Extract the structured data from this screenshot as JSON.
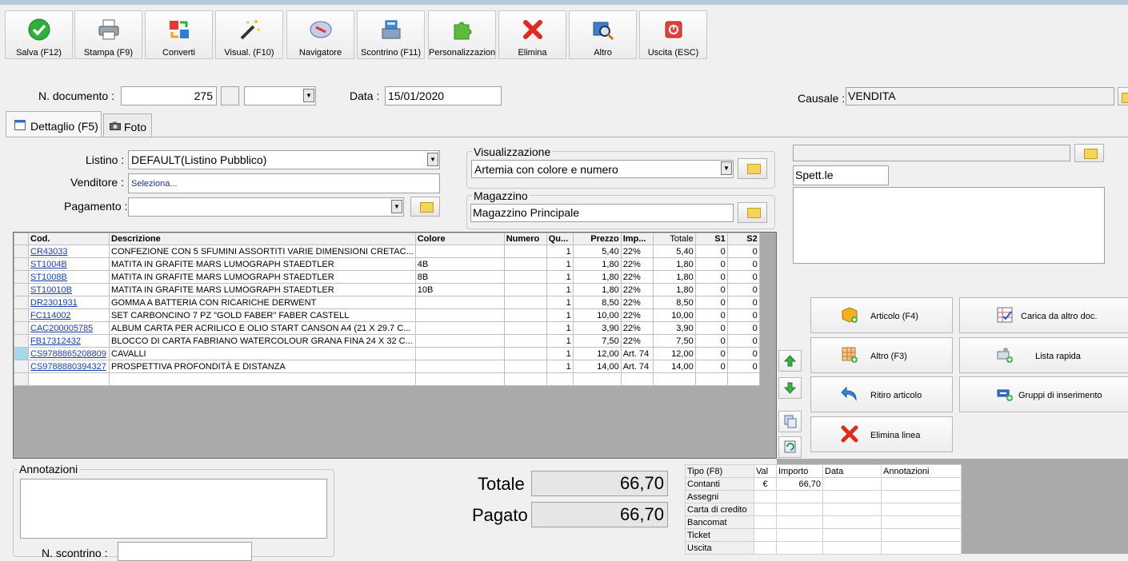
{
  "toolbar": {
    "items": [
      {
        "label": "Salva (F12)"
      },
      {
        "label": "Stampa (F9)"
      },
      {
        "label": "Converti"
      },
      {
        "label": "Visual. (F10)"
      },
      {
        "label": "Navigatore"
      },
      {
        "label": "Scontrino (F11)"
      },
      {
        "label": "Personalizzazioni"
      },
      {
        "label": "Elimina"
      },
      {
        "label": "Altro"
      },
      {
        "label": "Uscita (ESC)"
      }
    ]
  },
  "header": {
    "doc_label": "N. documento :",
    "doc_value": "275",
    "date_label": "Data :",
    "date_value": "15/01/2020",
    "causale_label": "Causale :",
    "causale_value": "VENDITA"
  },
  "tabs": [
    {
      "label": "Dettaglio (F5)"
    },
    {
      "label": "Foto"
    }
  ],
  "form": {
    "listino_label": "Listino :",
    "listino_value": "DEFAULT(Listino Pubblico)",
    "venditore_label": "Venditore :",
    "venditore_value": "Seleziona...",
    "pagamento_label": "Pagamento :",
    "pagamento_value": ""
  },
  "visualizzazione": {
    "label": "Visualizzazione",
    "value": "Artemia con colore e numero"
  },
  "magazzino": {
    "label": "Magazzino",
    "value": "Magazzino Principale"
  },
  "customer": {
    "name_value": "",
    "salutation": "Spett.le",
    "address": ""
  },
  "grid": {
    "columns": [
      "Cod.",
      "Descrizione",
      "Colore",
      "Numero",
      "Qu...",
      "Prezzo",
      "Imp...",
      "Totale",
      "S1",
      "S2"
    ],
    "rows": [
      {
        "cod": "CR43033",
        "desc": "CONFEZIONE CON 5 SFUMINI ASSORTITI VARIE DIMENSIONI CRETAC...",
        "colore": "",
        "numero": "",
        "qta": "1",
        "prezzo": "5,40",
        "imp": "22%",
        "totale": "5,40",
        "s1": "0",
        "s2": "0"
      },
      {
        "cod": "ST1004B",
        "desc": "MATITA IN GRAFITE MARS LUMOGRAPH STAEDTLER",
        "colore": "4B",
        "numero": "",
        "qta": "1",
        "prezzo": "1,80",
        "imp": "22%",
        "totale": "1,80",
        "s1": "0",
        "s2": "0"
      },
      {
        "cod": "ST1008B",
        "desc": "MATITA IN GRAFITE MARS LUMOGRAPH STAEDTLER",
        "colore": "8B",
        "numero": "",
        "qta": "1",
        "prezzo": "1,80",
        "imp": "22%",
        "totale": "1,80",
        "s1": "0",
        "s2": "0"
      },
      {
        "cod": "ST10010B",
        "desc": "MATITA IN GRAFITE MARS LUMOGRAPH STAEDTLER",
        "colore": "10B",
        "numero": "",
        "qta": "1",
        "prezzo": "1,80",
        "imp": "22%",
        "totale": "1,80",
        "s1": "0",
        "s2": "0"
      },
      {
        "cod": "DR2301931",
        "desc": "GOMMA A BATTERIA CON RICARICHE DERWENT",
        "colore": "",
        "numero": "",
        "qta": "1",
        "prezzo": "8,50",
        "imp": "22%",
        "totale": "8,50",
        "s1": "0",
        "s2": "0"
      },
      {
        "cod": "FC114002",
        "desc": "SET CARBONCINO 7 PZ \"GOLD FABER\" FABER CASTELL",
        "colore": "",
        "numero": "",
        "qta": "1",
        "prezzo": "10,00",
        "imp": "22%",
        "totale": "10,00",
        "s1": "0",
        "s2": "0"
      },
      {
        "cod": "CAC200005785",
        "desc": "ALBUM CARTA PER ACRILICO E OLIO START CANSON A4 (21 X 29.7 C...",
        "colore": "",
        "numero": "",
        "qta": "1",
        "prezzo": "3,90",
        "imp": "22%",
        "totale": "3,90",
        "s1": "0",
        "s2": "0"
      },
      {
        "cod": "FB17312432",
        "desc": "BLOCCO DI CARTA FABRIANO WATERCOLOUR GRANA FINA 24 X 32 C...",
        "colore": "",
        "numero": "",
        "qta": "1",
        "prezzo": "7,50",
        "imp": "22%",
        "totale": "7,50",
        "s1": "0",
        "s2": "0"
      },
      {
        "cod": "CS9788865208809",
        "desc": "CAVALLI",
        "colore": "",
        "numero": "",
        "qta": "1",
        "prezzo": "12,00",
        "imp": "Art. 74",
        "totale": "12,00",
        "s1": "0",
        "s2": "0"
      },
      {
        "cod": "CS9788880394327",
        "desc": "PROSPETTIVA PROFONDITÀ E DISTANZA",
        "colore": "",
        "numero": "",
        "qta": "1",
        "prezzo": "14,00",
        "imp": "Art. 74",
        "totale": "14,00",
        "s1": "0",
        "s2": "0"
      }
    ]
  },
  "actions": {
    "articolo": "Articolo (F4)",
    "carica": "Carica da altro doc.",
    "altro": "Altro (F3)",
    "lista": "Lista rapida",
    "ritiro": "Ritiro articolo",
    "gruppi": "Gruppi di inserimento",
    "elimina_linea": "Elimina linea"
  },
  "annotazioni": {
    "label": "Annotazioni",
    "value": ""
  },
  "scontrino": {
    "label": "N. scontrino :",
    "value": ""
  },
  "totals": {
    "totale_label": "Totale",
    "totale_value": "66,70",
    "pagato_label": "Pagato",
    "pagato_value": "66,70"
  },
  "payments": {
    "columns": [
      "Tipo (F8)",
      "Val",
      "Importo",
      "Data",
      "Annotazioni"
    ],
    "rows": [
      {
        "tipo": "Contanti",
        "val": "€",
        "importo": "66,70",
        "data": "",
        "note": ""
      },
      {
        "tipo": "Assegni",
        "val": "",
        "importo": "",
        "data": "",
        "note": ""
      },
      {
        "tipo": "Carta di credito",
        "val": "",
        "importo": "",
        "data": "",
        "note": ""
      },
      {
        "tipo": "Bancomat",
        "val": "",
        "importo": "",
        "data": "",
        "note": ""
      },
      {
        "tipo": "Ticket",
        "val": "",
        "importo": "",
        "data": "",
        "note": ""
      },
      {
        "tipo": "Uscita",
        "val": "",
        "importo": "",
        "data": "",
        "note": ""
      }
    ]
  }
}
